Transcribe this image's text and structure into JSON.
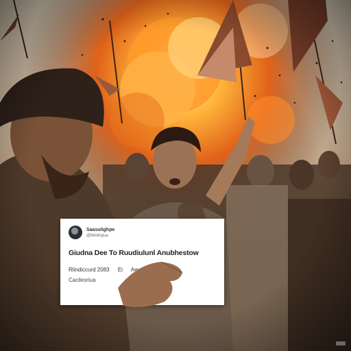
{
  "post_card": {
    "account_name": "Saasulighpe",
    "account_sub": "@liiiivlinpua",
    "headline": "Giudna Dee To Ruudiulunl Anubhestow",
    "meta_left": "Rlindiccurd 2083",
    "meta_mid": "Ei",
    "meta_right": "Aeuwolg",
    "meta_line2": "Cacilesriua"
  },
  "colors": {
    "fire": "#ff8a1e",
    "smoke": "#d9c7ad",
    "card_bg": "#ffffff"
  }
}
